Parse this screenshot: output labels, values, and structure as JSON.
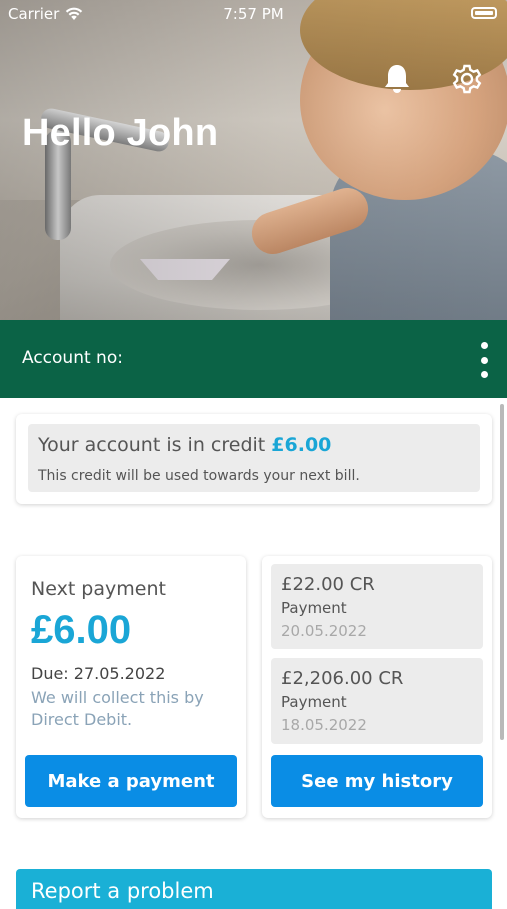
{
  "status_bar": {
    "carrier": "Carrier",
    "time": "7:57 PM"
  },
  "hero": {
    "greeting": "Hello John"
  },
  "header_icons": {
    "notifications": "bell-icon",
    "settings": "gear-icon"
  },
  "account": {
    "label": "Account no:",
    "menu_icon": "more-vertical-icon"
  },
  "credit": {
    "title_prefix": "Your account is in credit",
    "amount": "£6.00",
    "subtitle": "This credit will be used towards your next bill."
  },
  "next_payment": {
    "heading": "Next payment",
    "amount": "£6.00",
    "due": "Due: 27.05.2022",
    "note": "We will collect this by Direct Debit.",
    "button_label": "Make a payment"
  },
  "history": {
    "items": [
      {
        "amount": "£22.00 CR",
        "type": "Payment",
        "date": "20.05.2022"
      },
      {
        "amount": "£2,206.00 CR",
        "type": "Payment",
        "date": "18.05.2022"
      }
    ],
    "button_label": "See my history"
  },
  "report": {
    "label": "Report a problem"
  },
  "colors": {
    "brand_green": "#0b6346",
    "accent_blue": "#0a8de5",
    "amount_blue": "#1aa6d6",
    "report_cyan": "#1ab0d6"
  }
}
